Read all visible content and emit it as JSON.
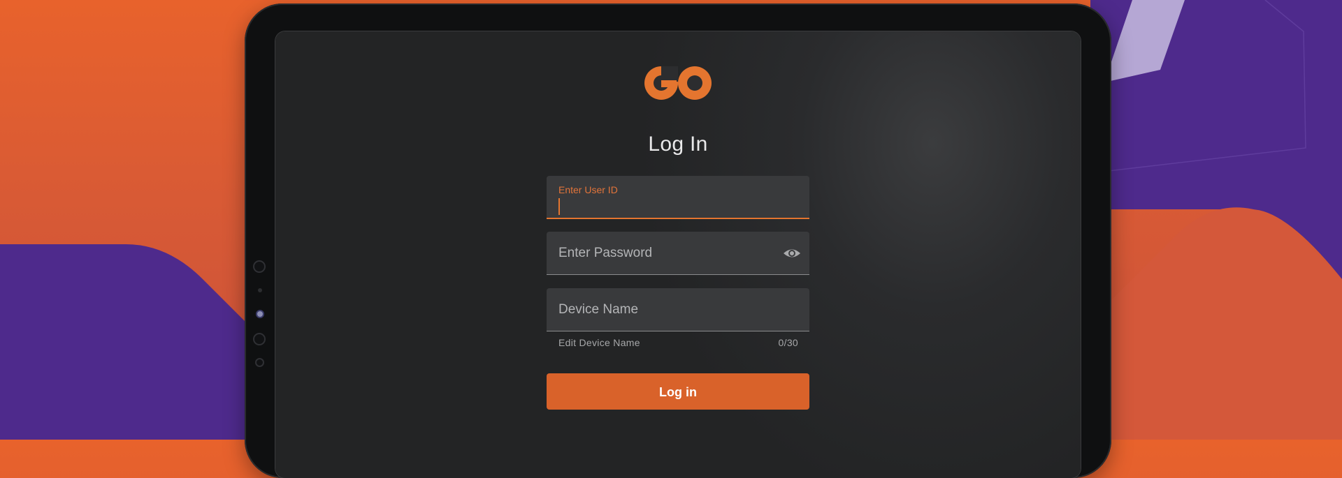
{
  "brand": {
    "logo_text": "GO",
    "accent_color": "#e4752f"
  },
  "login": {
    "title": "Log In",
    "user_id": {
      "label": "Enter User ID",
      "value": ""
    },
    "password": {
      "placeholder": "Enter Password",
      "visibility_icon": "eye-icon"
    },
    "device_name": {
      "placeholder": "Device Name",
      "helper": "Edit Device Name",
      "counter": "0/30"
    },
    "submit_label": "Log in"
  },
  "colors": {
    "background_orange": "#e8622c",
    "background_purple": "#4e2a8c",
    "button": "#d9622a",
    "screen": "#2a2b2d"
  }
}
